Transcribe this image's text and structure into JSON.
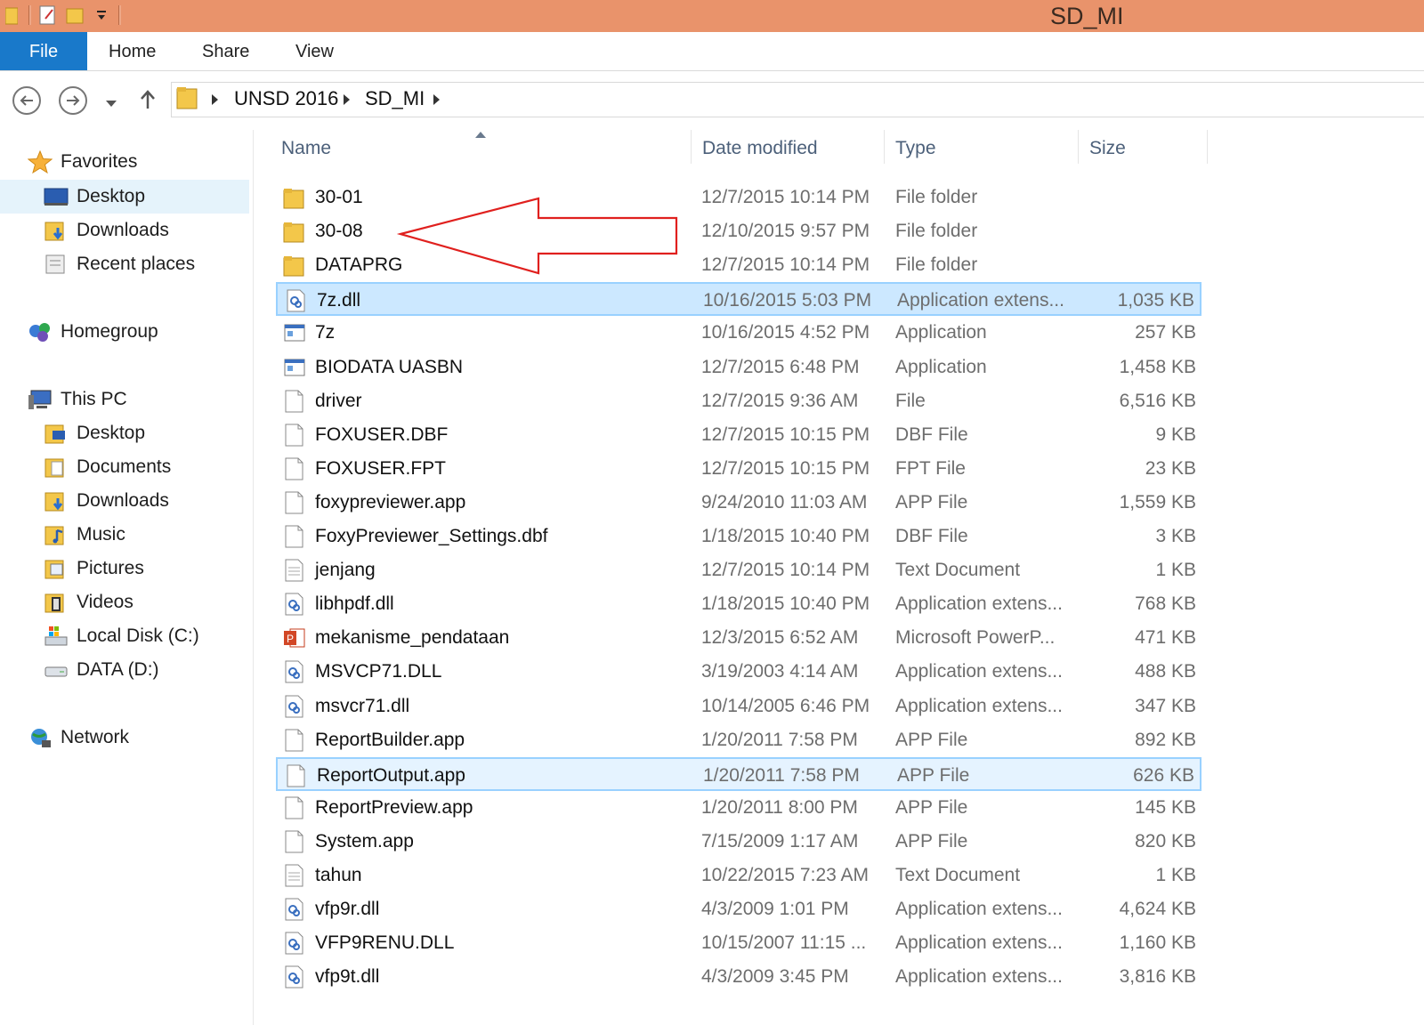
{
  "window": {
    "title": "SD_MI"
  },
  "ribbon": {
    "tabs": [
      "File",
      "Home",
      "Share",
      "View"
    ]
  },
  "address": {
    "crumbs": [
      "UNSD 2016",
      "SD_MI"
    ]
  },
  "navpane": {
    "favorites": {
      "label": "Favorites",
      "items": [
        "Desktop",
        "Downloads",
        "Recent places"
      ]
    },
    "homegroup": "Homegroup",
    "thispc": {
      "label": "This PC",
      "items": [
        "Desktop",
        "Documents",
        "Downloads",
        "Music",
        "Pictures",
        "Videos",
        "Local Disk (C:)",
        "DATA (D:)"
      ]
    },
    "network": "Network"
  },
  "columns": {
    "name": "Name",
    "date": "Date modified",
    "type": "Type",
    "size": "Size"
  },
  "files": [
    {
      "name": "30-01",
      "date": "12/7/2015 10:14 PM",
      "type": "File folder",
      "size": "",
      "icon": "folder-icon"
    },
    {
      "name": "30-08",
      "date": "12/10/2015 9:57 PM",
      "type": "File folder",
      "size": "",
      "icon": "folder-icon"
    },
    {
      "name": "DATAPRG",
      "date": "12/7/2015 10:14 PM",
      "type": "File folder",
      "size": "",
      "icon": "folder-icon"
    },
    {
      "name": "7z.dll",
      "date": "10/16/2015 5:03 PM",
      "type": "Application extens...",
      "size": "1,035 KB",
      "icon": "dll-icon"
    },
    {
      "name": "7z",
      "date": "10/16/2015 4:52 PM",
      "type": "Application",
      "size": "257 KB",
      "icon": "app-icon"
    },
    {
      "name": "BIODATA UASBN",
      "date": "12/7/2015 6:48 PM",
      "type": "Application",
      "size": "1,458 KB",
      "icon": "app-icon"
    },
    {
      "name": "driver",
      "date": "12/7/2015 9:36 AM",
      "type": "File",
      "size": "6,516 KB",
      "icon": "file-icon"
    },
    {
      "name": "FOXUSER.DBF",
      "date": "12/7/2015 10:15 PM",
      "type": "DBF File",
      "size": "9 KB",
      "icon": "file-icon"
    },
    {
      "name": "FOXUSER.FPT",
      "date": "12/7/2015 10:15 PM",
      "type": "FPT File",
      "size": "23 KB",
      "icon": "file-icon"
    },
    {
      "name": "foxypreviewer.app",
      "date": "9/24/2010 11:03 AM",
      "type": "APP File",
      "size": "1,559 KB",
      "icon": "file-icon"
    },
    {
      "name": "FoxyPreviewer_Settings.dbf",
      "date": "1/18/2015 10:40 PM",
      "type": "DBF File",
      "size": "3 KB",
      "icon": "file-icon"
    },
    {
      "name": "jenjang",
      "date": "12/7/2015 10:14 PM",
      "type": "Text Document",
      "size": "1 KB",
      "icon": "text-file-icon"
    },
    {
      "name": "libhpdf.dll",
      "date": "1/18/2015 10:40 PM",
      "type": "Application extens...",
      "size": "768 KB",
      "icon": "dll-icon"
    },
    {
      "name": "mekanisme_pendataan",
      "date": "12/3/2015 6:52 AM",
      "type": "Microsoft PowerP...",
      "size": "471 KB",
      "icon": "powerpoint-icon"
    },
    {
      "name": "MSVCP71.DLL",
      "date": "3/19/2003 4:14 AM",
      "type": "Application extens...",
      "size": "488 KB",
      "icon": "dll-icon"
    },
    {
      "name": "msvcr71.dll",
      "date": "10/14/2005 6:46 PM",
      "type": "Application extens...",
      "size": "347 KB",
      "icon": "dll-icon"
    },
    {
      "name": "ReportBuilder.app",
      "date": "1/20/2011 7:58 PM",
      "type": "APP File",
      "size": "892 KB",
      "icon": "file-icon"
    },
    {
      "name": "ReportOutput.app",
      "date": "1/20/2011 7:58 PM",
      "type": "APP File",
      "size": "626 KB",
      "icon": "file-icon"
    },
    {
      "name": "ReportPreview.app",
      "date": "1/20/2011 8:00 PM",
      "type": "APP File",
      "size": "145 KB",
      "icon": "file-icon"
    },
    {
      "name": "System.app",
      "date": "7/15/2009 1:17 AM",
      "type": "APP File",
      "size": "820 KB",
      "icon": "file-icon"
    },
    {
      "name": "tahun",
      "date": "10/22/2015 7:23 AM",
      "type": "Text Document",
      "size": "1 KB",
      "icon": "text-file-icon"
    },
    {
      "name": "vfp9r.dll",
      "date": "4/3/2009 1:01 PM",
      "type": "Application extens...",
      "size": "4,624 KB",
      "icon": "dll-icon"
    },
    {
      "name": "VFP9RENU.DLL",
      "date": "10/15/2007 11:15 ...",
      "type": "Application extens...",
      "size": "1,160 KB",
      "icon": "dll-icon"
    },
    {
      "name": "vfp9t.dll",
      "date": "4/3/2009 3:45 PM",
      "type": "Application extens...",
      "size": "3,816 KB",
      "icon": "dll-icon"
    }
  ],
  "colors": {
    "titlebar": "#e9936b",
    "file_tab": "#1979ca",
    "selection": "#cce8ff",
    "annotation": "#e0201e"
  }
}
